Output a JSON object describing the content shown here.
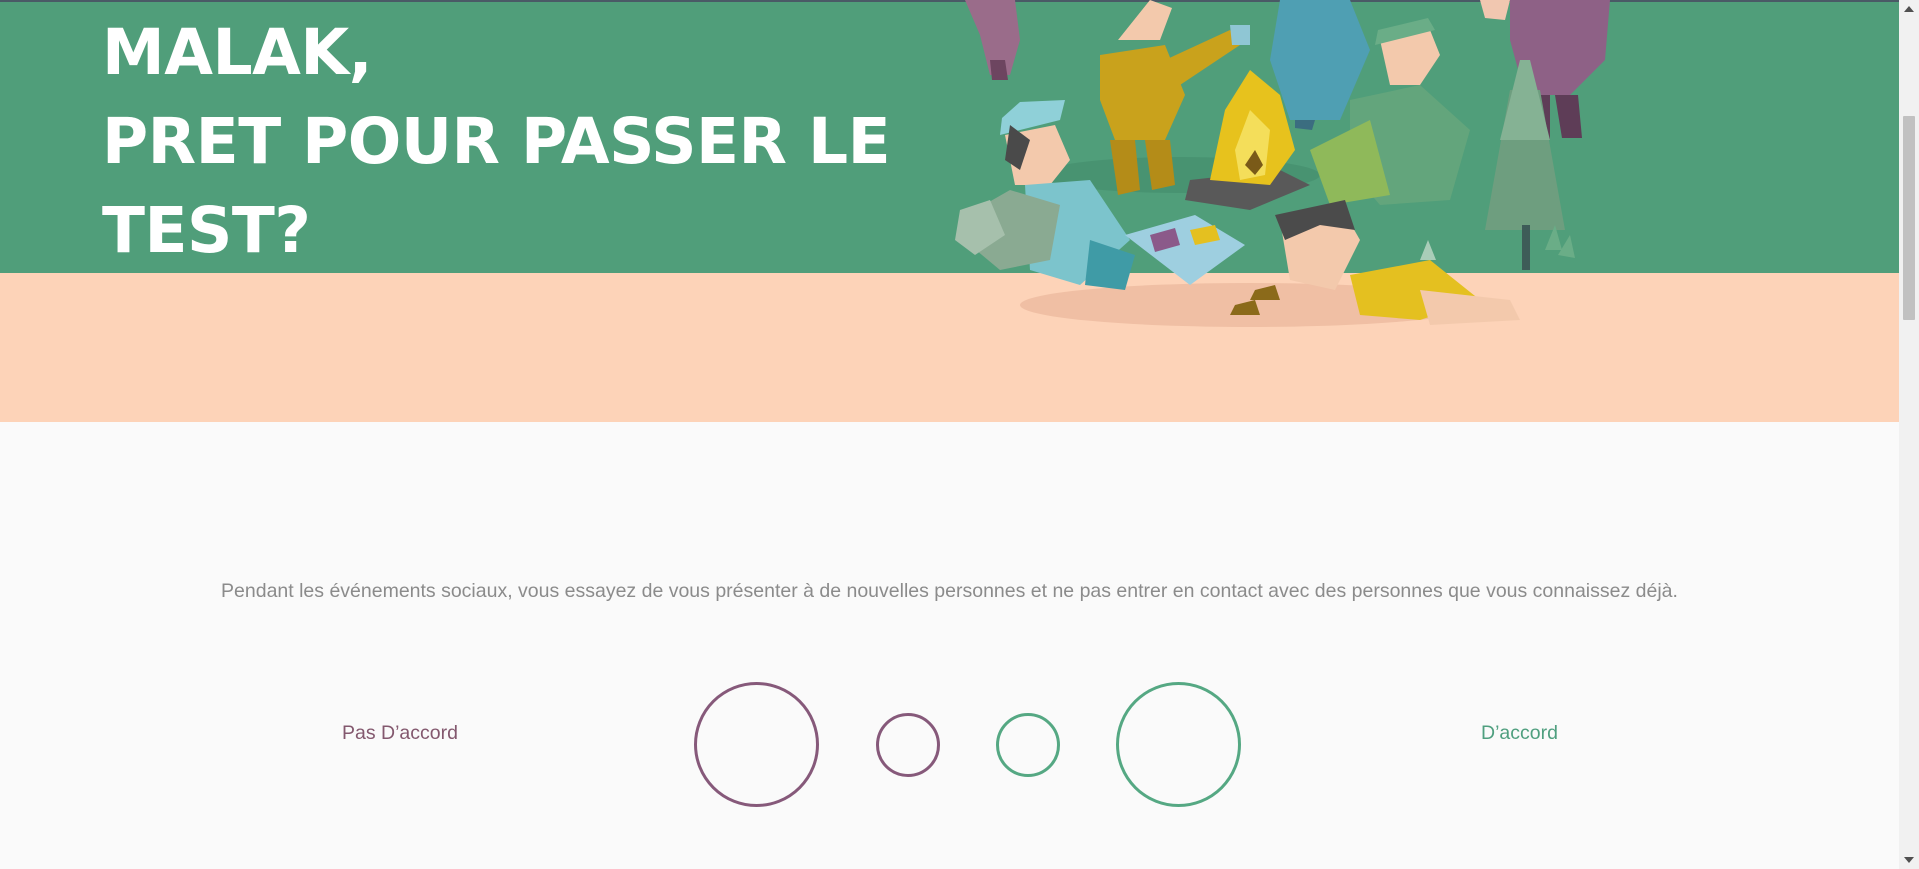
{
  "hero": {
    "title_lines": [
      "MALAK,",
      "PRET POUR PASSER LE",
      "TEST?"
    ],
    "illustration_icon": "campfire-scene-illustration",
    "colors": {
      "green": "#509e7a",
      "peach": "#fdd3b8"
    }
  },
  "question": {
    "text": "Pendant les événements sociaux, vous essayez de vous présenter à de nouvelles personnes et ne pas entrer en contact avec des personnes que vous connaissez déjà.",
    "disagree_label": "Pas D’accord",
    "agree_label": "D’accord",
    "options": [
      {
        "name": "answer-option-strong-disagree",
        "color": "#86597a"
      },
      {
        "name": "answer-option-disagree",
        "color": "#86597a"
      },
      {
        "name": "answer-option-agree",
        "color": "#55a883"
      },
      {
        "name": "answer-option-strong-agree",
        "color": "#55a883"
      }
    ]
  }
}
